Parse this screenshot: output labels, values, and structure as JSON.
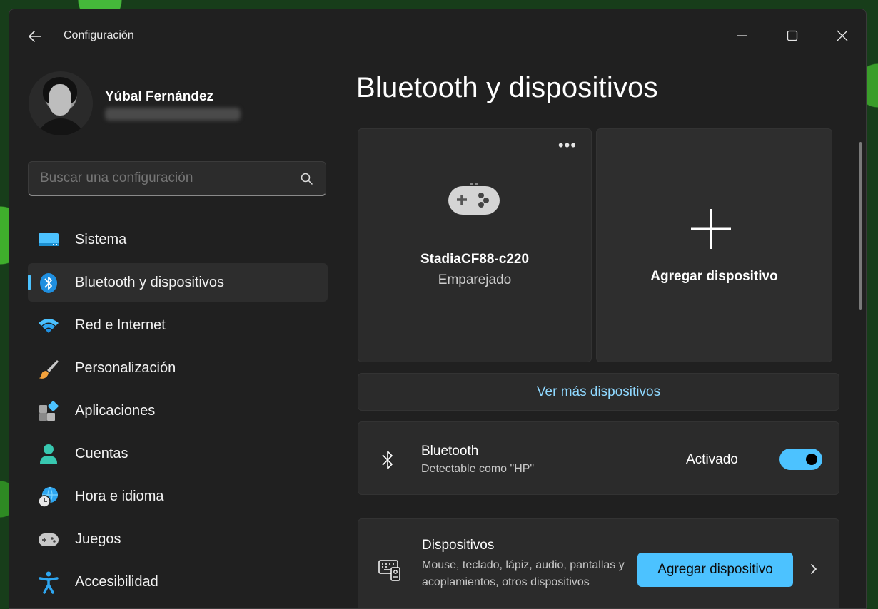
{
  "window": {
    "title": "Configuración"
  },
  "profile": {
    "name": "Yúbal Fernández"
  },
  "search": {
    "placeholder": "Buscar una configuración"
  },
  "nav": {
    "items": [
      {
        "label": "Sistema",
        "icon": "monitor-icon"
      },
      {
        "label": "Bluetooth y dispositivos",
        "icon": "bluetooth-icon",
        "active": true
      },
      {
        "label": "Red e Internet",
        "icon": "wifi-icon"
      },
      {
        "label": "Personalización",
        "icon": "paintbrush-icon"
      },
      {
        "label": "Aplicaciones",
        "icon": "apps-icon"
      },
      {
        "label": "Cuentas",
        "icon": "person-icon"
      },
      {
        "label": "Hora e idioma",
        "icon": "globe-clock-icon"
      },
      {
        "label": "Juegos",
        "icon": "gamepad-icon"
      },
      {
        "label": "Accesibilidad",
        "icon": "accessibility-icon"
      }
    ]
  },
  "main": {
    "title": "Bluetooth y dispositivos",
    "device_card": {
      "name": "StadiaCF88-c220",
      "status": "Emparejado",
      "more": "•••"
    },
    "add_card": {
      "label": "Agregar dispositivo"
    },
    "more_devices": "Ver más dispositivos",
    "bluetooth": {
      "title": "Bluetooth",
      "subtitle": "Detectable como \"HP\"",
      "state": "Activado",
      "on": true
    },
    "devices": {
      "title": "Dispositivos",
      "description": "Mouse, teclado, lápiz, audio, pantallas y acoplamientos, otros dispositivos",
      "button": "Agregar dispositivo"
    }
  },
  "colors": {
    "accent": "#4cc2ff",
    "background": "#202020",
    "card": "#2b2b2b"
  }
}
